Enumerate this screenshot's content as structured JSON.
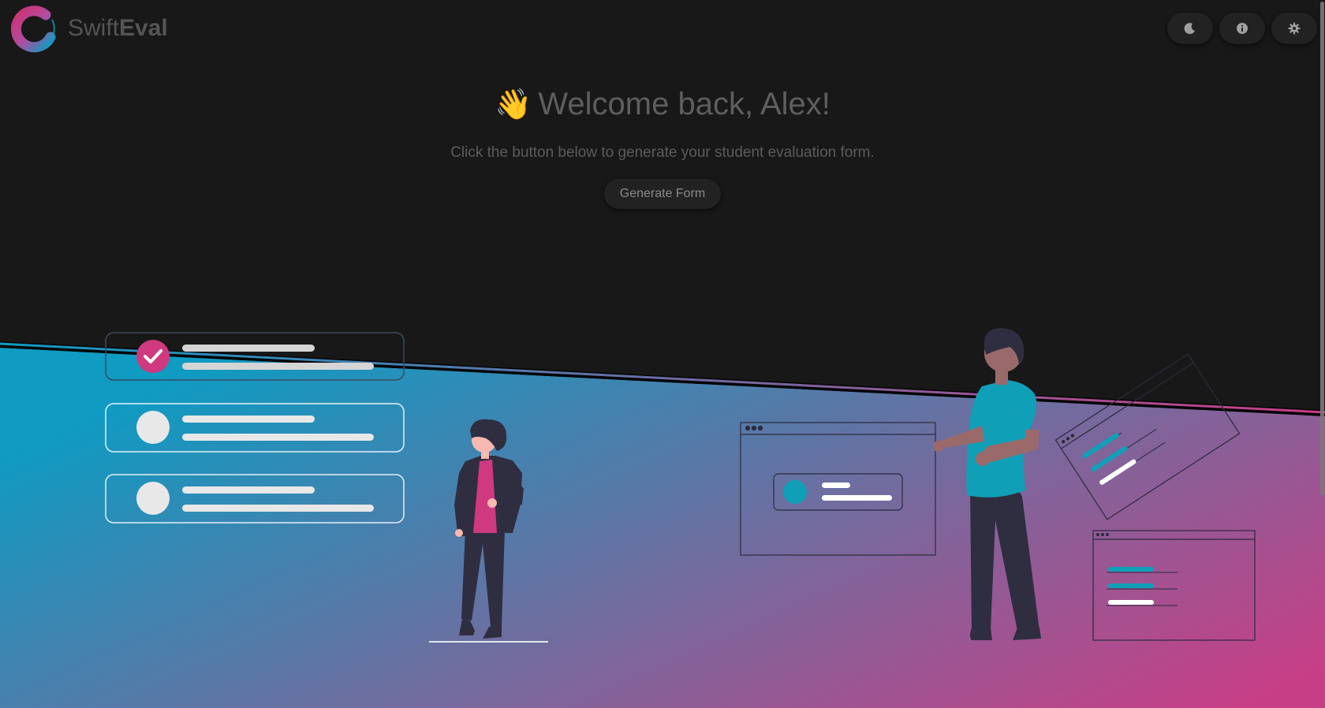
{
  "app": {
    "name_light": "Swift",
    "name_bold": "Eval"
  },
  "toolbar": {
    "buttons": [
      {
        "icon": "moon-icon",
        "label": "Toggle dark mode"
      },
      {
        "icon": "info-icon",
        "label": "About"
      },
      {
        "icon": "gear-icon",
        "label": "Settings"
      }
    ]
  },
  "hero": {
    "emoji": "👋",
    "welcome": "Welcome back, Alex!",
    "subtitle": "Click the button below to generate your student evaluation form.",
    "button_label": "Generate Form"
  },
  "colors": {
    "background": "#181818",
    "gradient_start": "#0f9ac0",
    "gradient_end": "#c73d86",
    "accent_pink": "#d0397f",
    "accent_teal": "#0fa0b8"
  }
}
